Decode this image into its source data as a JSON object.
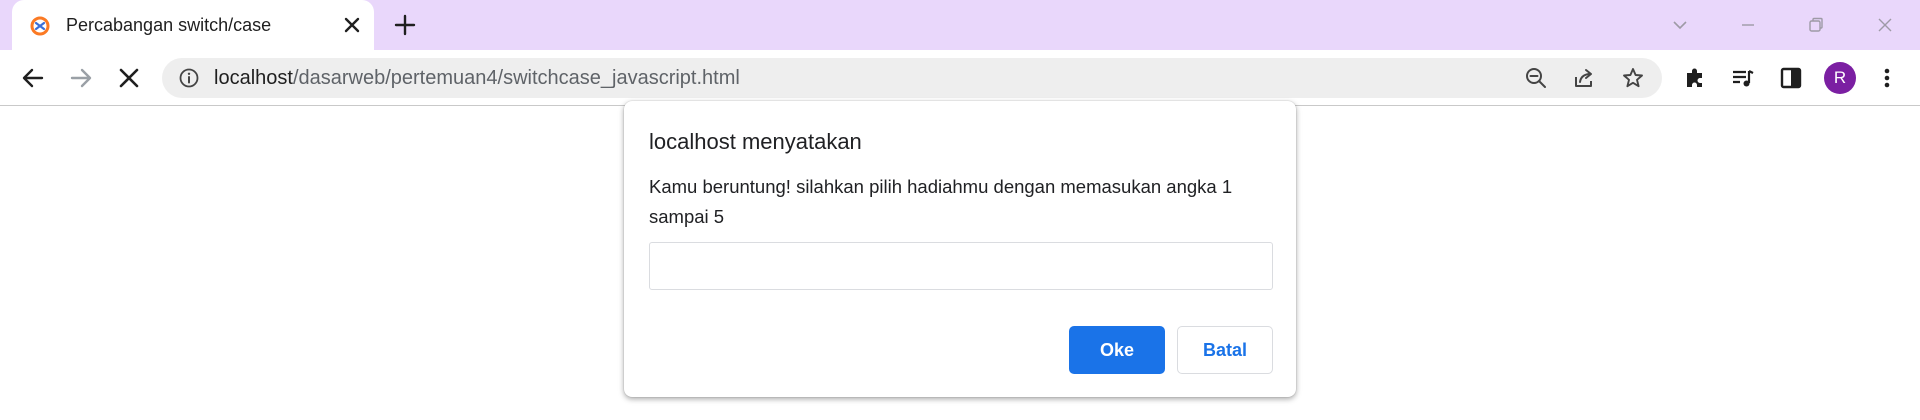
{
  "browser": {
    "tab": {
      "title": "Percabangan switch/case"
    },
    "url": {
      "host": "localhost",
      "path": "/dasarweb/pertemuan4/switchcase_javascript.html"
    },
    "profile_initial": "R"
  },
  "dialog": {
    "title": "localhost menyatakan",
    "message": "Kamu beruntung! silahkan pilih hadiahmu dengan memasukan angka 1 sampai 5",
    "input_value": "",
    "ok_label": "Oke",
    "cancel_label": "Batal"
  },
  "colors": {
    "tab_strip": "#e9d7fb",
    "accent": "#1a73e8",
    "avatar": "#7b1fa2"
  }
}
